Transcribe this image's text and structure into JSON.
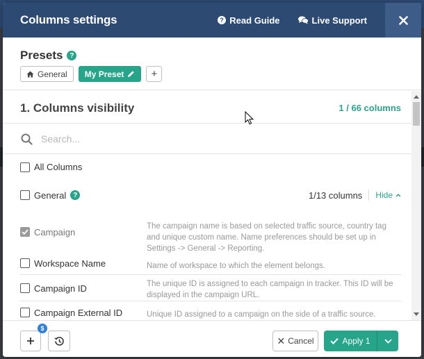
{
  "modal": {
    "title": "Columns settings",
    "read_guide": "Read Guide",
    "live_support": "Live Support",
    "close": "✕"
  },
  "presets": {
    "title": "Presets",
    "help": "?",
    "items": [
      {
        "label": "General",
        "icon": "home-icon",
        "active": false
      },
      {
        "label": "My Preset",
        "icon": "pencil-icon",
        "active": true
      }
    ],
    "add_label": "+"
  },
  "visibility": {
    "title": "1. Columns visibility",
    "count": "1 / 66 columns",
    "search_placeholder": "Search...",
    "all_columns_label": "All Columns",
    "general_group": {
      "label": "General",
      "help": "?",
      "count": "1/13 columns",
      "toggle_label": "Hide"
    },
    "columns": [
      {
        "name": "Campaign",
        "checked": true,
        "disabled": true,
        "description": "The campaign name is based on selected traffic source, country tag and unique custom name. Name preferences should be set up in Settings -> General -> Reporting."
      },
      {
        "name": "Workspace Name",
        "checked": false,
        "disabled": false,
        "description": "Name of workspace to which the element belongs."
      },
      {
        "name": "Campaign ID",
        "checked": false,
        "disabled": false,
        "description": "The unique ID is assigned to each campaign in tracker. This ID will be displayed in the campaign URL."
      },
      {
        "name": "Campaign External ID",
        "checked": false,
        "disabled": false,
        "description": "Unique ID assigned to a campaign on the side of a traffic source."
      }
    ]
  },
  "footer": {
    "add_badge": "$",
    "cancel_label": "Cancel",
    "apply_label": "Apply 1"
  },
  "colors": {
    "header_bg": "#2d4a73",
    "accent_green": "#27a58a",
    "badge_blue": "#2f7ee0"
  }
}
